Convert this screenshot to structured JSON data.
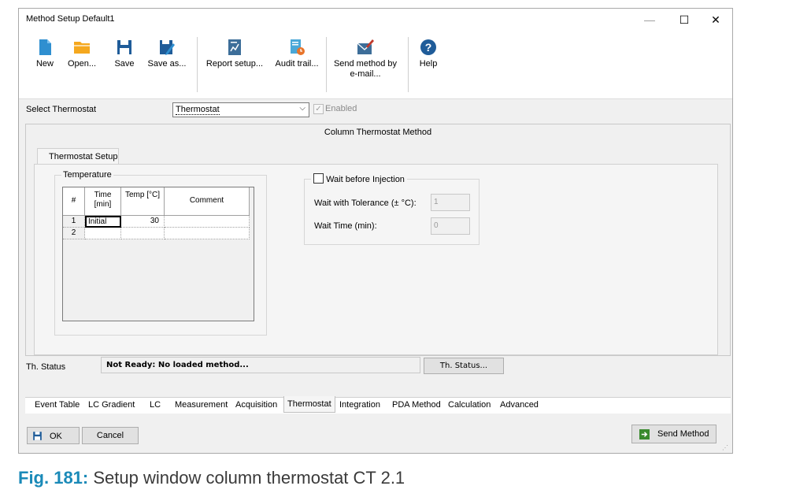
{
  "window": {
    "title": "Method Setup Default1",
    "controls": {
      "minimize": "—",
      "maximize": "☐",
      "close": "✕"
    }
  },
  "toolbar": {
    "items": [
      {
        "label": "New",
        "icon": "new-document-icon"
      },
      {
        "label": "Open...",
        "icon": "folder-icon"
      },
      {
        "label": "Save",
        "icon": "floppy-disk-icon"
      },
      {
        "label": "Save as...",
        "icon": "save-as-icon"
      },
      {
        "label": "Report setup...",
        "icon": "report-icon"
      },
      {
        "label": "Audit trail...",
        "icon": "audit-trail-icon"
      },
      {
        "label": "Send method by e-mail...",
        "icon": "email-icon"
      },
      {
        "label": "Help",
        "icon": "help-icon"
      }
    ]
  },
  "thermostat_select": {
    "label": "Select Thermostat",
    "value": "Thermostat",
    "enabled_label": "Enabled",
    "enabled_checked": true
  },
  "method": {
    "title": "Column Thermostat Method",
    "tab": "Thermostat Setup",
    "temperature_group": "Temperature",
    "table": {
      "headers": {
        "num": "#",
        "time": "Time [min]",
        "temp": "Temp [°C]",
        "comment": "Comment"
      },
      "rows": [
        {
          "num": "1",
          "time": "Initial",
          "temp": "30",
          "comment": ""
        },
        {
          "num": "2",
          "time": "",
          "temp": "",
          "comment": ""
        }
      ]
    },
    "wait": {
      "checkbox_label": "Wait before Injection",
      "checked": false,
      "tolerance_label": "Wait with Tolerance (± °C):",
      "tolerance_value": "1",
      "time_label": "Wait Time (min):",
      "time_value": "0"
    }
  },
  "status": {
    "label": "Th. Status",
    "value": "Not Ready: No loaded method...",
    "button": "Th. Status..."
  },
  "bottom_tabs": [
    "Event Table",
    "LC Gradient",
    "LC",
    "Measurement",
    "Acquisition",
    "Thermostat",
    "Integration",
    "PDA Method",
    "Calculation",
    "Advanced"
  ],
  "bottom_tabs_active": "Thermostat",
  "footer": {
    "ok": "OK",
    "cancel": "Cancel",
    "send": "Send Method"
  },
  "caption": {
    "fig": "Fig. 181:",
    "text": "Setup window column thermostat CT 2.1"
  },
  "colors": {
    "accent_blue": "#1f5c99",
    "folder_orange": "#f5a81e",
    "caption_blue": "#1a8ab8"
  }
}
